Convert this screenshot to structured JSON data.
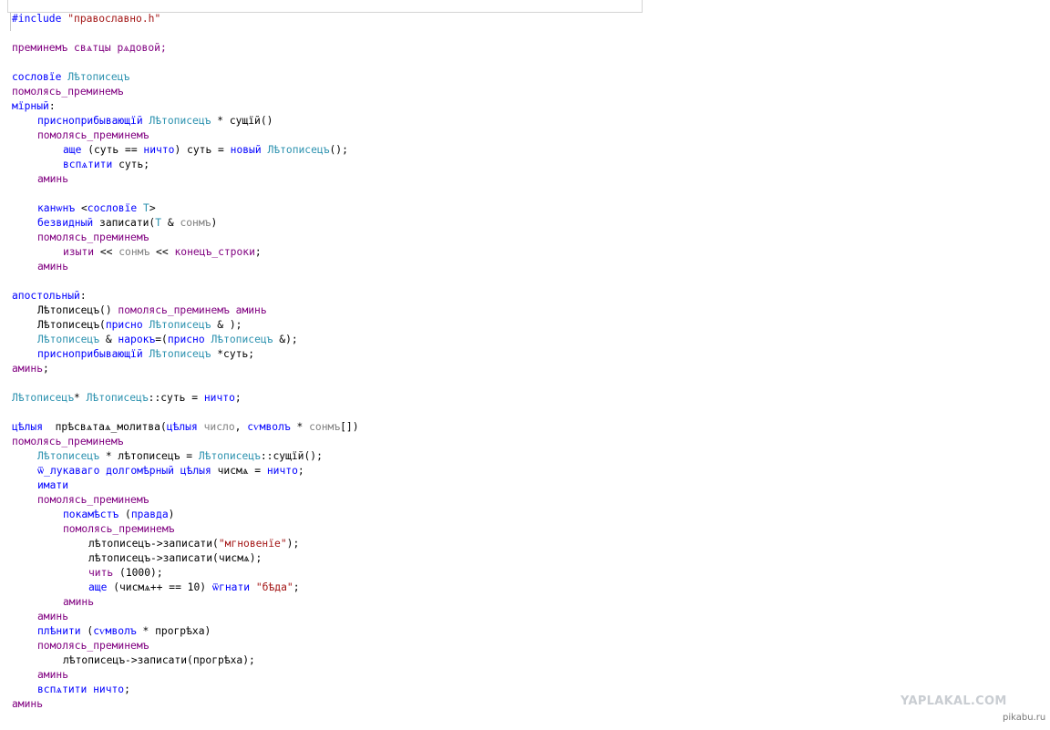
{
  "editor": {
    "lines": [
      {
        "indent": 0,
        "tokens": [
          {
            "t": "#include",
            "c": "kw"
          },
          {
            "t": " "
          },
          {
            "t": "\"православно.h\"",
            "c": "str"
          }
        ]
      },
      {
        "indent": 0,
        "tokens": []
      },
      {
        "indent": 0,
        "tokens": [
          {
            "t": "преминемъ свѧтцы рѧдовой;",
            "c": "mac"
          }
        ]
      },
      {
        "indent": 0,
        "tokens": []
      },
      {
        "indent": 0,
        "tokens": [
          {
            "t": "сословїе",
            "c": "kw"
          },
          {
            "t": " "
          },
          {
            "t": "Лѣтописецъ",
            "c": "ty"
          }
        ]
      },
      {
        "indent": 0,
        "tokens": [
          {
            "t": "помолясь_преминемъ",
            "c": "mac"
          }
        ]
      },
      {
        "indent": 0,
        "tokens": [
          {
            "t": "мїрный",
            "c": "kw"
          },
          {
            "t": ":"
          }
        ]
      },
      {
        "indent": 1,
        "tokens": [
          {
            "t": "присноприбывающїй",
            "c": "kw"
          },
          {
            "t": " "
          },
          {
            "t": "Лѣтописецъ",
            "c": "ty"
          },
          {
            "t": " * сущїй()"
          }
        ]
      },
      {
        "indent": 1,
        "tokens": [
          {
            "t": "помолясь_преминемъ",
            "c": "mac"
          }
        ]
      },
      {
        "indent": 2,
        "tokens": [
          {
            "t": "аще",
            "c": "kw"
          },
          {
            "t": " (суть == "
          },
          {
            "t": "ничто",
            "c": "kw"
          },
          {
            "t": ") суть = "
          },
          {
            "t": "новый",
            "c": "kw"
          },
          {
            "t": " "
          },
          {
            "t": "Лѣтописецъ",
            "c": "ty"
          },
          {
            "t": "();"
          }
        ]
      },
      {
        "indent": 2,
        "tokens": [
          {
            "t": "вспѧтити",
            "c": "kw"
          },
          {
            "t": " суть;"
          }
        ]
      },
      {
        "indent": 1,
        "tokens": [
          {
            "t": "аминь",
            "c": "mac"
          }
        ]
      },
      {
        "indent": 0,
        "tokens": []
      },
      {
        "indent": 1,
        "tokens": [
          {
            "t": "канѡнъ",
            "c": "kw"
          },
          {
            "t": " <"
          },
          {
            "t": "сословїе",
            "c": "kw"
          },
          {
            "t": " "
          },
          {
            "t": "Т",
            "c": "ty"
          },
          {
            "t": ">"
          }
        ]
      },
      {
        "indent": 1,
        "tokens": [
          {
            "t": "безвидный",
            "c": "kw"
          },
          {
            "t": " записати("
          },
          {
            "t": "Т",
            "c": "ty"
          },
          {
            "t": " & "
          },
          {
            "t": "сонмъ",
            "c": "par"
          },
          {
            "t": ")"
          }
        ]
      },
      {
        "indent": 1,
        "tokens": [
          {
            "t": "помолясь_преминемъ",
            "c": "mac"
          }
        ]
      },
      {
        "indent": 2,
        "tokens": [
          {
            "t": "изыти",
            "c": "mac"
          },
          {
            "t": " << "
          },
          {
            "t": "сонмъ",
            "c": "par"
          },
          {
            "t": " << "
          },
          {
            "t": "конецъ_строки",
            "c": "mac"
          },
          {
            "t": ";"
          }
        ]
      },
      {
        "indent": 1,
        "tokens": [
          {
            "t": "аминь",
            "c": "mac"
          }
        ]
      },
      {
        "indent": 0,
        "tokens": []
      },
      {
        "indent": 0,
        "tokens": [
          {
            "t": "апостольный",
            "c": "kw"
          },
          {
            "t": ":"
          }
        ]
      },
      {
        "indent": 1,
        "tokens": [
          {
            "t": "Лѣтописецъ() "
          },
          {
            "t": "помолясь_преминемъ аминь",
            "c": "mac"
          }
        ]
      },
      {
        "indent": 1,
        "tokens": [
          {
            "t": "Лѣтописецъ("
          },
          {
            "t": "присно",
            "c": "kw"
          },
          {
            "t": " "
          },
          {
            "t": "Лѣтописецъ",
            "c": "ty"
          },
          {
            "t": " & );"
          }
        ]
      },
      {
        "indent": 1,
        "tokens": [
          {
            "t": "Лѣтописецъ",
            "c": "ty"
          },
          {
            "t": " & "
          },
          {
            "t": "нарокъ",
            "c": "kw"
          },
          {
            "t": "=("
          },
          {
            "t": "присно",
            "c": "kw"
          },
          {
            "t": " "
          },
          {
            "t": "Лѣтописецъ",
            "c": "ty"
          },
          {
            "t": " &);"
          }
        ]
      },
      {
        "indent": 1,
        "tokens": [
          {
            "t": "присноприбывающїй",
            "c": "kw"
          },
          {
            "t": " "
          },
          {
            "t": "Лѣтописецъ",
            "c": "ty"
          },
          {
            "t": " *суть;"
          }
        ]
      },
      {
        "indent": 0,
        "tokens": [
          {
            "t": "аминь",
            "c": "mac"
          },
          {
            "t": ";"
          }
        ]
      },
      {
        "indent": 0,
        "tokens": []
      },
      {
        "indent": 0,
        "tokens": [
          {
            "t": "Лѣтописецъ",
            "c": "ty"
          },
          {
            "t": "* "
          },
          {
            "t": "Лѣтописецъ",
            "c": "ty"
          },
          {
            "t": "::суть = "
          },
          {
            "t": "ничто",
            "c": "kw"
          },
          {
            "t": ";"
          }
        ]
      },
      {
        "indent": 0,
        "tokens": []
      },
      {
        "indent": 0,
        "tokens": [
          {
            "t": "цѣлыя",
            "c": "kw"
          },
          {
            "t": "  прѣсвѧтаѧ_молитва("
          },
          {
            "t": "цѣлыя",
            "c": "kw"
          },
          {
            "t": " "
          },
          {
            "t": "число",
            "c": "par"
          },
          {
            "t": ", "
          },
          {
            "t": "сѵмволъ",
            "c": "kw"
          },
          {
            "t": " * "
          },
          {
            "t": "сонмъ",
            "c": "par"
          },
          {
            "t": "[])"
          }
        ]
      },
      {
        "indent": 0,
        "tokens": [
          {
            "t": "помолясь_преминемъ",
            "c": "mac"
          }
        ]
      },
      {
        "indent": 1,
        "tokens": [
          {
            "t": "Лѣтописецъ",
            "c": "ty"
          },
          {
            "t": " * лѣтописецъ = "
          },
          {
            "t": "Лѣтописецъ",
            "c": "ty"
          },
          {
            "t": "::сущїй();"
          }
        ]
      },
      {
        "indent": 1,
        "tokens": [
          {
            "t": "ѿ_лукаваго долгомѣрный цѣлыя",
            "c": "kw"
          },
          {
            "t": " чисмѧ = "
          },
          {
            "t": "ничто",
            "c": "kw"
          },
          {
            "t": ";"
          }
        ]
      },
      {
        "indent": 1,
        "tokens": [
          {
            "t": "имати",
            "c": "kw"
          }
        ]
      },
      {
        "indent": 1,
        "tokens": [
          {
            "t": "помолясь_преминемъ",
            "c": "mac"
          }
        ]
      },
      {
        "indent": 2,
        "tokens": [
          {
            "t": "покамѣстъ",
            "c": "kw"
          },
          {
            "t": " ("
          },
          {
            "t": "правда",
            "c": "kw"
          },
          {
            "t": ")"
          }
        ]
      },
      {
        "indent": 2,
        "tokens": [
          {
            "t": "помолясь_преминемъ",
            "c": "mac"
          }
        ]
      },
      {
        "indent": 3,
        "tokens": [
          {
            "t": "лѣтописецъ->записати("
          },
          {
            "t": "\"мгновенїе\"",
            "c": "str"
          },
          {
            "t": ");"
          }
        ]
      },
      {
        "indent": 3,
        "tokens": [
          {
            "t": "лѣтописецъ->записати(чисмѧ);"
          }
        ]
      },
      {
        "indent": 3,
        "tokens": [
          {
            "t": "чить",
            "c": "mac"
          },
          {
            "t": " (1000);"
          }
        ]
      },
      {
        "indent": 3,
        "tokens": [
          {
            "t": "аще",
            "c": "kw"
          },
          {
            "t": " (чисмѧ++ == 10) "
          },
          {
            "t": "ѿгнати",
            "c": "kw"
          },
          {
            "t": " "
          },
          {
            "t": "\"бѣда\"",
            "c": "str"
          },
          {
            "t": ";"
          }
        ]
      },
      {
        "indent": 2,
        "tokens": [
          {
            "t": "аминь",
            "c": "mac"
          }
        ]
      },
      {
        "indent": 1,
        "tokens": [
          {
            "t": "аминь",
            "c": "mac"
          }
        ]
      },
      {
        "indent": 1,
        "tokens": [
          {
            "t": "плѣнити",
            "c": "kw"
          },
          {
            "t": " ("
          },
          {
            "t": "сѵмволъ",
            "c": "kw"
          },
          {
            "t": " * прогрѣха)"
          }
        ]
      },
      {
        "indent": 1,
        "tokens": [
          {
            "t": "помолясь_преминемъ",
            "c": "mac"
          }
        ]
      },
      {
        "indent": 2,
        "tokens": [
          {
            "t": "лѣтописецъ->записати(прогрѣха);"
          }
        ]
      },
      {
        "indent": 1,
        "tokens": [
          {
            "t": "аминь",
            "c": "mac"
          }
        ]
      },
      {
        "indent": 1,
        "tokens": [
          {
            "t": "вспѧтити",
            "c": "kw"
          },
          {
            "t": " "
          },
          {
            "t": "ничто",
            "c": "kw"
          },
          {
            "t": ";"
          }
        ]
      },
      {
        "indent": 0,
        "tokens": [
          {
            "t": "аминь",
            "c": "mac"
          }
        ]
      }
    ]
  },
  "watermark": {
    "site": "YAPLAKAL.COM",
    "host": "pikabu.ru"
  }
}
